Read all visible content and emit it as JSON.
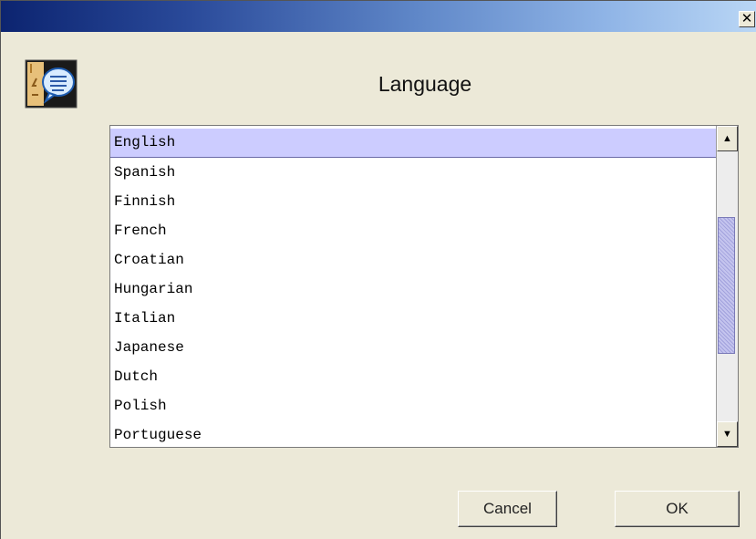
{
  "window": {
    "close_glyph": "✕"
  },
  "header": {
    "icon": "speech-bubble-chat-icon",
    "title": "Language"
  },
  "language_list": {
    "items": [
      "English",
      "Spanish",
      "Finnish",
      "French",
      "Croatian",
      "Hungarian",
      "Italian",
      "Japanese",
      "Dutch",
      "Polish",
      "Portuguese"
    ],
    "selected": "English",
    "scroll_up_glyph": "▲",
    "scroll_down_glyph": "▼"
  },
  "buttons": {
    "cancel_label": "Cancel",
    "ok_label": "OK"
  },
  "colors": {
    "selection": "#ccccff",
    "titlebar_start": "#0c2470",
    "titlebar_end": "#b9d6f5",
    "dialog_background": "#ece9d8"
  }
}
